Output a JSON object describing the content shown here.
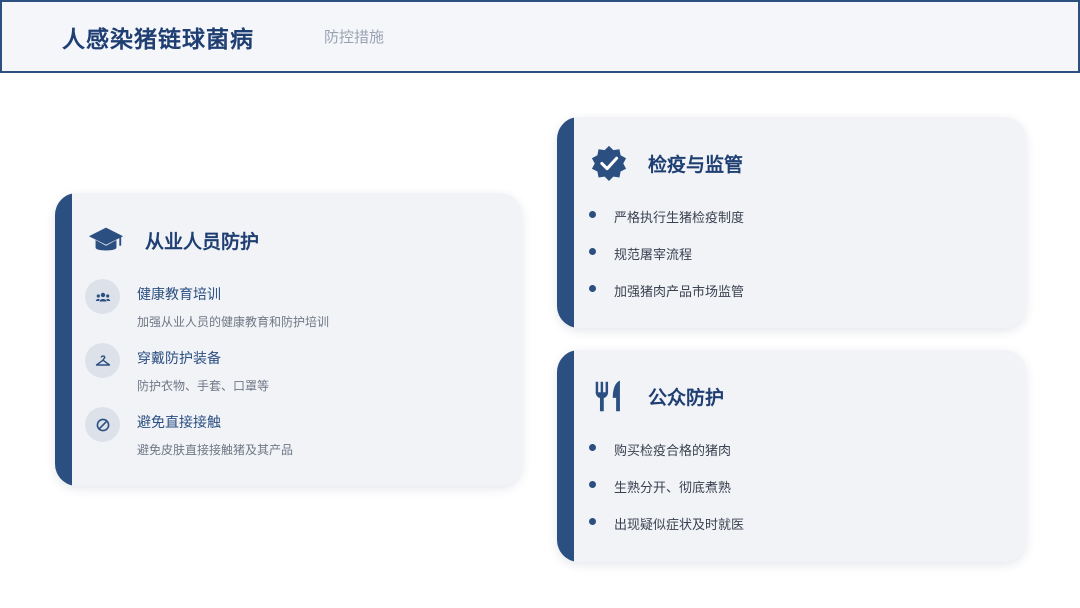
{
  "header": {
    "title": "人感染猪链球菌病",
    "subtitle": "防控措施"
  },
  "colors": {
    "accent": "#2c4f82",
    "card_bg": "#f1f3f7",
    "icon_bubble": "#dde2ea"
  },
  "worker_card": {
    "icon": "graduation-cap-icon",
    "title": "从业人员防护",
    "items": [
      {
        "icon": "people-group-icon",
        "title": "健康教育培训",
        "desc": "加强从业人员的健康教育和防护培训"
      },
      {
        "icon": "clothes-hanger-icon",
        "title": "穿戴防护装备",
        "desc": "防护衣物、手套、口罩等"
      },
      {
        "icon": "ban-icon",
        "title": "避免直接接触",
        "desc": "避免皮肤直接接触猪及其产品"
      }
    ]
  },
  "inspection_card": {
    "icon": "certificate-check-icon",
    "title": "检疫与监管",
    "bullets": [
      "严格执行生猪检疫制度",
      "规范屠宰流程",
      "加强猪肉产品市场监管"
    ]
  },
  "public_card": {
    "icon": "utensils-icon",
    "title": "公众防护",
    "bullets": [
      "购买检疫合格的猪肉",
      "生熟分开、彻底煮熟",
      "出现疑似症状及时就医"
    ]
  }
}
